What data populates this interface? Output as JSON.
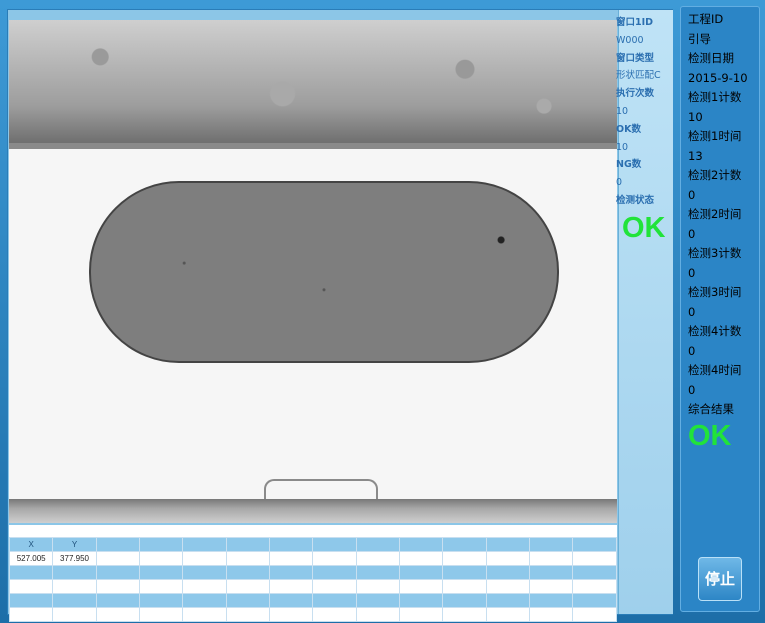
{
  "info": {
    "window_id_label": "窗口1ID",
    "window_id_value": "W000",
    "window_type_label": "窗口类型",
    "window_type_value": "形状匹配C",
    "exec_count_label": "执行次数",
    "exec_count_value": "10",
    "ok_count_label": "OK数",
    "ok_count_value": "10",
    "ng_count_label": "NG数",
    "ng_count_value": "0",
    "status_label": "检测状态",
    "status_value": "OK"
  },
  "side": {
    "project_id_label": "工程ID",
    "guide_label": "引导",
    "date_label": "检测日期",
    "date_value": "2015-9-10",
    "d1_count_label": "检测1计数",
    "d1_count_value": "10",
    "d1_time_label": "检测1时间",
    "d1_time_value": "13",
    "d2_count_label": "检测2计数",
    "d2_count_value": "0",
    "d2_time_label": "检测2时间",
    "d2_time_value": "0",
    "d3_count_label": "检测3计数",
    "d3_count_value": "0",
    "d3_time_label": "检测3时间",
    "d3_time_value": "0",
    "d4_count_label": "检测4计数",
    "d4_count_value": "0",
    "d4_time_label": "检测4时间",
    "d4_time_value": "0",
    "result_label": "综合结果",
    "result_value": "OK",
    "stop_button": "停止"
  },
  "table": {
    "headers": [
      "X",
      "Y"
    ],
    "rows": [
      [
        "527.005",
        "377.950"
      ]
    ]
  },
  "colors": {
    "ok": "#21e33a",
    "panel": "#2b85c6",
    "stripe": "#8ec8ea"
  }
}
